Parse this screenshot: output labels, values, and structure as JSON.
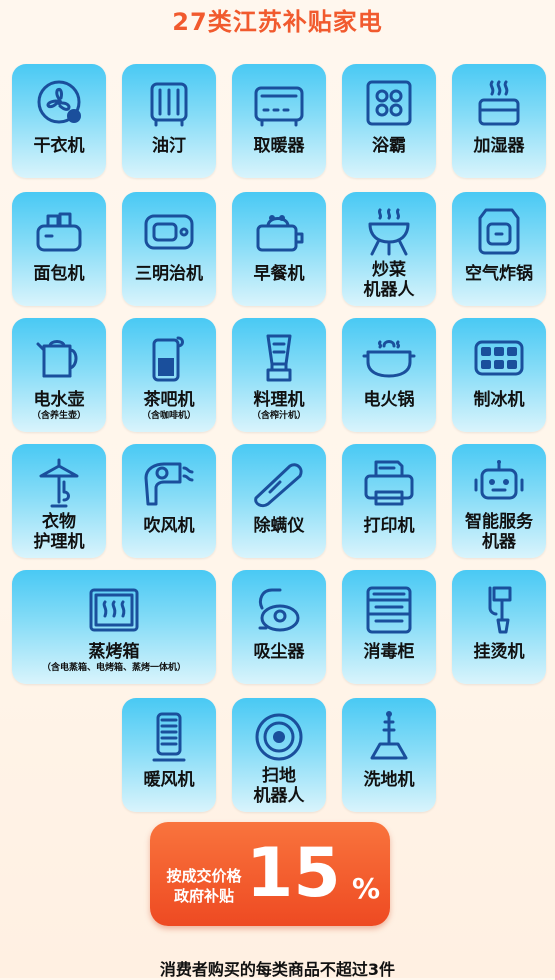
{
  "title": "27类江苏补贴家电",
  "items": [
    {
      "label": "干衣机",
      "icon": "fan-dryer-icon"
    },
    {
      "label": "油汀",
      "icon": "oil-heater-icon"
    },
    {
      "label": "取暖器",
      "icon": "heater-icon"
    },
    {
      "label": "浴霸",
      "icon": "bath-heater-icon"
    },
    {
      "label": "加湿器",
      "icon": "humidifier-icon"
    },
    {
      "label": "面包机",
      "icon": "toaster-icon"
    },
    {
      "label": "三明治机",
      "icon": "sandwich-maker-icon"
    },
    {
      "label": "早餐机",
      "icon": "breakfast-maker-icon"
    },
    {
      "label": "炒菜",
      "label2": "机器人",
      "icon": "cooking-robot-icon"
    },
    {
      "label": "空气炸锅",
      "icon": "air-fryer-icon"
    },
    {
      "label": "电水壶",
      "sub": "（含养生壶）",
      "icon": "kettle-icon"
    },
    {
      "label": "茶吧机",
      "sub": "（含咖啡机）",
      "icon": "tea-bar-icon"
    },
    {
      "label": "料理机",
      "sub": "（含榨汁机）",
      "icon": "blender-icon"
    },
    {
      "label": "电火锅",
      "icon": "hot-pot-icon"
    },
    {
      "label": "制冰机",
      "icon": "ice-maker-icon"
    },
    {
      "label": "衣物",
      "label2": "护理机",
      "icon": "garment-steamer-icon"
    },
    {
      "label": "吹风机",
      "icon": "hair-dryer-icon"
    },
    {
      "label": "除螨仪",
      "icon": "mite-remover-icon"
    },
    {
      "label": "打印机",
      "icon": "printer-icon"
    },
    {
      "label": "智能服务",
      "label2": "机器",
      "icon": "robot-icon"
    },
    {
      "label": "蒸烤箱",
      "sub": "（含电蒸箱、电烤箱、蒸烤一体机）",
      "icon": "steam-oven-icon"
    },
    {
      "label": "吸尘器",
      "icon": "vacuum-icon"
    },
    {
      "label": "消毒柜",
      "icon": "sterilizer-cabinet-icon"
    },
    {
      "label": "挂烫机",
      "icon": "steam-iron-icon"
    },
    {
      "label": "暖风机",
      "icon": "fan-heater-icon"
    },
    {
      "label": "扫地",
      "label2": "机器人",
      "icon": "robot-vacuum-icon"
    },
    {
      "label": "洗地机",
      "icon": "floor-washer-icon"
    }
  ],
  "badge": {
    "line1": "按成交价格",
    "line2": "政府补贴",
    "number": "15",
    "symbol": "%"
  },
  "footer": "消费者购买的每类商品不超过3件",
  "colors": {
    "accent": "#f15a2e",
    "tile": "#5ccdf5",
    "icon": "#1a4f9c"
  }
}
